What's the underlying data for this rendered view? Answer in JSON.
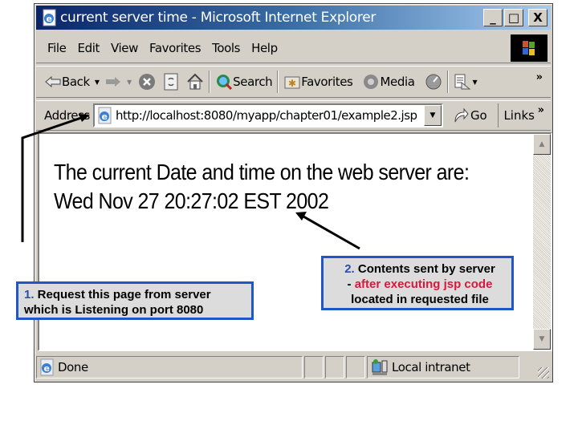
{
  "window": {
    "title": "current server time - Microsoft Internet Explorer",
    "controls": {
      "minimize": "_",
      "maximize": "□",
      "close": "X"
    }
  },
  "menubar": {
    "items": [
      "File",
      "Edit",
      "View",
      "Favorites",
      "Tools",
      "Help"
    ]
  },
  "toolbar": {
    "back_label": "Back",
    "search_label": "Search",
    "favorites_label": "Favorites",
    "media_label": "Media",
    "overflow": "»",
    "icons": [
      "back-arrow-icon",
      "forward-arrow-icon",
      "stop-icon",
      "refresh-icon",
      "home-icon",
      "search-globe-icon",
      "favorites-folder-icon",
      "media-icon",
      "history-icon",
      "mail-icon"
    ]
  },
  "addressbar": {
    "label": "Address",
    "url": "http://localhost:8080/myapp/chapter01/example2.jsp",
    "go_label": "Go",
    "links_label": "Links",
    "overflow": "»"
  },
  "page": {
    "line1": "The current Date and time on the web server are:",
    "line2": "Wed Nov 27 20:27:02 EST 2002"
  },
  "statusbar": {
    "status": "Done",
    "zone": "Local intranet"
  },
  "annotations": {
    "callout1": {
      "number": "1.",
      "line1": " Request this page from server",
      "line2": "which is Listening on port 8080"
    },
    "callout2": {
      "number": "2.",
      "line1": " Contents sent by server",
      "line2_prefix": "- ",
      "line2_highlight": "after executing jsp code",
      "line3": "located in requested file"
    },
    "colors": {
      "border": "#2255cc",
      "number": "#2a4fb0",
      "highlight": "#d8183c",
      "fill": "#dcdcdc"
    }
  }
}
